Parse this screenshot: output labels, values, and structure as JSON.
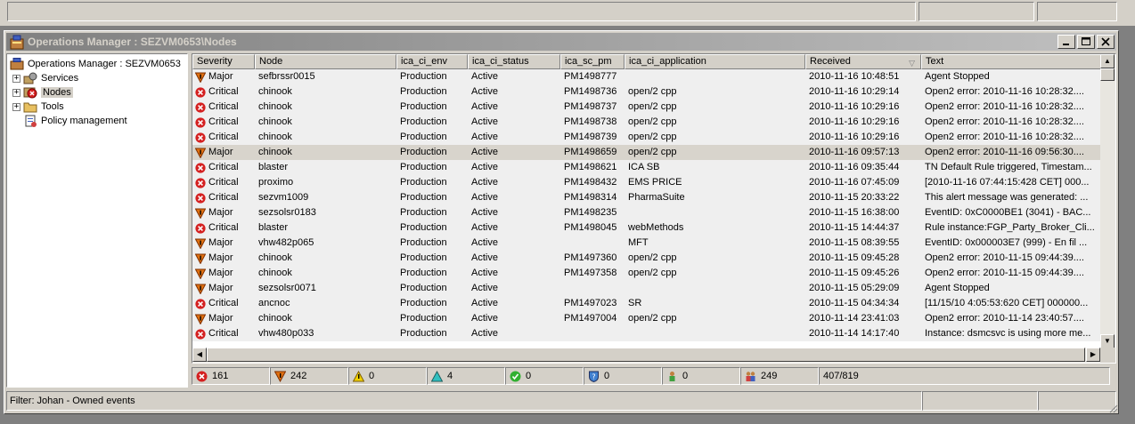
{
  "window": {
    "title": "Operations Manager : SEZVM0653\\Nodes"
  },
  "tree": {
    "root_label": "Operations Manager : SEZVM0653",
    "items": [
      {
        "label": "Services",
        "icon": "services-icon",
        "expander": "+"
      },
      {
        "label": "Nodes",
        "icon": "nodes-icon",
        "expander": "+"
      },
      {
        "label": "Tools",
        "icon": "tools-folder-icon",
        "expander": "+"
      },
      {
        "label": "Policy management",
        "icon": "policy-icon",
        "expander": ""
      }
    ]
  },
  "grid": {
    "columns": [
      "Severity",
      "Node",
      "ica_ci_env",
      "ica_ci_status",
      "ica_sc_pm",
      "ica_ci_application",
      "Received",
      "Text"
    ],
    "rows": [
      {
        "severity": "Major",
        "node": "sefbrssr0015",
        "env": "Production",
        "status": "Active",
        "pm": "PM1498777",
        "app": "",
        "received": "2010-11-16  10:48:51",
        "text": "Agent Stopped"
      },
      {
        "severity": "Critical",
        "node": "chinook",
        "env": "Production",
        "status": "Active",
        "pm": "PM1498736",
        "app": "open/2 cpp",
        "received": "2010-11-16  10:29:14",
        "text": "Open2 error: 2010-11-16 10:28:32...."
      },
      {
        "severity": "Critical",
        "node": "chinook",
        "env": "Production",
        "status": "Active",
        "pm": "PM1498737",
        "app": "open/2 cpp",
        "received": "2010-11-16  10:29:16",
        "text": "Open2 error: 2010-11-16 10:28:32...."
      },
      {
        "severity": "Critical",
        "node": "chinook",
        "env": "Production",
        "status": "Active",
        "pm": "PM1498738",
        "app": "open/2 cpp",
        "received": "2010-11-16  10:29:16",
        "text": "Open2 error: 2010-11-16 10:28:32...."
      },
      {
        "severity": "Critical",
        "node": "chinook",
        "env": "Production",
        "status": "Active",
        "pm": "PM1498739",
        "app": "open/2 cpp",
        "received": "2010-11-16  10:29:16",
        "text": "Open2 error: 2010-11-16 10:28:32...."
      },
      {
        "severity": "Major",
        "node": "chinook",
        "env": "Production",
        "status": "Active",
        "pm": "PM1498659",
        "app": "open/2 cpp",
        "received": "2010-11-16  09:57:13",
        "text": "Open2 error: 2010-11-16 09:56:30...."
      },
      {
        "severity": "Critical",
        "node": "blaster",
        "env": "Production",
        "status": "Active",
        "pm": "PM1498621",
        "app": "ICA SB",
        "received": "2010-11-16  09:35:44",
        "text": "TN Default Rule triggered, Timestam..."
      },
      {
        "severity": "Critical",
        "node": "proximo",
        "env": "Production",
        "status": "Active",
        "pm": "PM1498432",
        "app": "EMS PRICE",
        "received": "2010-11-16  07:45:09",
        "text": "[2010-11-16 07:44:15:428 CET] 000..."
      },
      {
        "severity": "Critical",
        "node": "sezvm1009",
        "env": "Production",
        "status": "Active",
        "pm": "PM1498314",
        "app": "PharmaSuite",
        "received": "2010-11-15  20:33:22",
        "text": "This alert message was generated: ..."
      },
      {
        "severity": "Major",
        "node": "sezsolsr0183",
        "env": "Production",
        "status": "Active",
        "pm": "PM1498235",
        "app": "",
        "received": "2010-11-15  16:38:00",
        "text": "EventID: 0xC0000BE1 (3041) - BAC..."
      },
      {
        "severity": "Critical",
        "node": "blaster",
        "env": "Production",
        "status": "Active",
        "pm": "PM1498045",
        "app": "webMethods",
        "received": "2010-11-15  14:44:37",
        "text": "Rule instance:FGP_Party_Broker_Cli..."
      },
      {
        "severity": "Major",
        "node": "vhw482p065",
        "env": "Production",
        "status": "Active",
        "pm": "",
        "app": "MFT",
        "received": "2010-11-15  08:39:55",
        "text": "EventID: 0x000003E7 (999) - En fil ..."
      },
      {
        "severity": "Major",
        "node": "chinook",
        "env": "Production",
        "status": "Active",
        "pm": "PM1497360",
        "app": "open/2 cpp",
        "received": "2010-11-15  09:45:28",
        "text": "Open2 error: 2010-11-15 09:44:39...."
      },
      {
        "severity": "Major",
        "node": "chinook",
        "env": "Production",
        "status": "Active",
        "pm": "PM1497358",
        "app": "open/2 cpp",
        "received": "2010-11-15  09:45:26",
        "text": "Open2 error: 2010-11-15 09:44:39...."
      },
      {
        "severity": "Major",
        "node": "sezsolsr0071",
        "env": "Production",
        "status": "Active",
        "pm": "",
        "app": "",
        "received": "2010-11-15  05:29:09",
        "text": "Agent Stopped"
      },
      {
        "severity": "Critical",
        "node": "ancnoc",
        "env": "Production",
        "status": "Active",
        "pm": "PM1497023",
        "app": "SR",
        "received": "2010-11-15  04:34:34",
        "text": "[11/15/10 4:05:53:620 CET] 000000..."
      },
      {
        "severity": "Major",
        "node": "chinook",
        "env": "Production",
        "status": "Active",
        "pm": "PM1497004",
        "app": "open/2 cpp",
        "received": "2010-11-14  23:41:03",
        "text": "Open2 error: 2010-11-14 23:40:57...."
      },
      {
        "severity": "Critical",
        "node": "vhw480p033",
        "env": "Production",
        "status": "Active",
        "pm": "",
        "app": "",
        "received": "2010-11-14  14:17:40",
        "text": "Instance: dsmcsvc is using more me..."
      }
    ]
  },
  "counts": {
    "critical": "161",
    "major": "242",
    "minor": "0",
    "warning": "4",
    "normal": "0",
    "unknown": "0",
    "owned_single": "0",
    "owned_multi": "249",
    "total": "407/819"
  },
  "filter": {
    "text": "Filter: Johan - Owned events"
  },
  "colors": {
    "critical": "#d42020",
    "major": "#e07010",
    "minor": "#f0d000",
    "warning": "#30c0c0",
    "normal": "#30b030",
    "unknown": "#4080d0"
  }
}
